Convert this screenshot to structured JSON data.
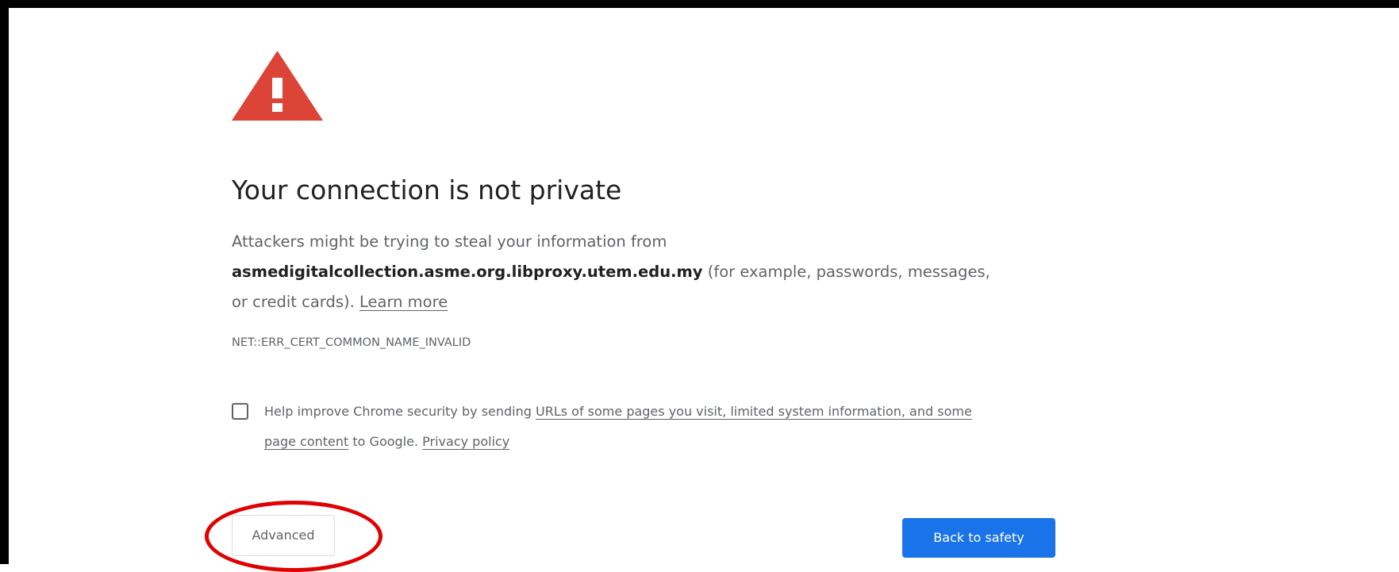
{
  "interstitial": {
    "title": "Your connection is not private",
    "description": {
      "line_prefix": "Attackers might be trying to steal your information from",
      "domain": "asmedigitalcollection.asme.org.libproxy.utem.edu.my",
      "line_suffix": "(for example, passwords, messages, or credit cards).",
      "learn_more": "Learn more"
    },
    "error_code": "NET::ERR_CERT_COMMON_NAME_INVALID",
    "optin": {
      "checked": false,
      "text_prefix": "Help improve Chrome security by sending",
      "link_urls": "URLs of some pages you visit, limited system information, and some page content",
      "text_middle": "to Google.",
      "link_privacy": "Privacy policy"
    },
    "buttons": {
      "advanced": "Advanced",
      "back_to_safety": "Back to safety"
    }
  },
  "icons": {
    "warning": "warning-triangle-icon"
  },
  "colors": {
    "warning_red": "#db4437",
    "primary_blue": "#1a73e8",
    "annotation_red": "#e00000"
  }
}
